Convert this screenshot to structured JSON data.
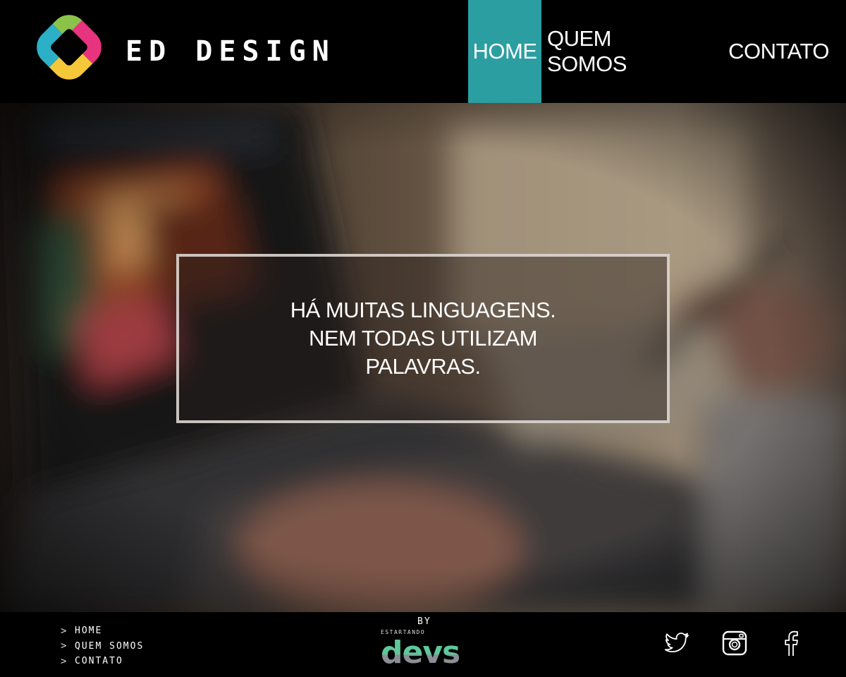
{
  "header": {
    "brand": "ED DESIGN",
    "nav": [
      {
        "label": "HOME",
        "active": true
      },
      {
        "label": "QUEM SOMOS",
        "active": false
      },
      {
        "label": "CONTATO",
        "active": false
      }
    ]
  },
  "hero": {
    "headline_lines": [
      "HÁ MUITAS LINGUAGENS.",
      "NEM TODAS UTILIZAM",
      "PALAVRAS."
    ]
  },
  "footer": {
    "links": [
      "HOME",
      "QUEM SOMOS",
      "CONTATO"
    ],
    "credit": {
      "by": "BY",
      "small": "ESTARTANDO",
      "logo_text": "devs"
    },
    "social": [
      "twitter-icon",
      "instagram-icon",
      "facebook-icon"
    ]
  },
  "colors": {
    "accent": "#2a9ea1",
    "background": "#000000",
    "text": "#ffffff",
    "logo_pink": "#e8337e",
    "logo_yellow": "#f4c839",
    "logo_blue": "#2cb0c8",
    "logo_green": "#8bc34a"
  }
}
